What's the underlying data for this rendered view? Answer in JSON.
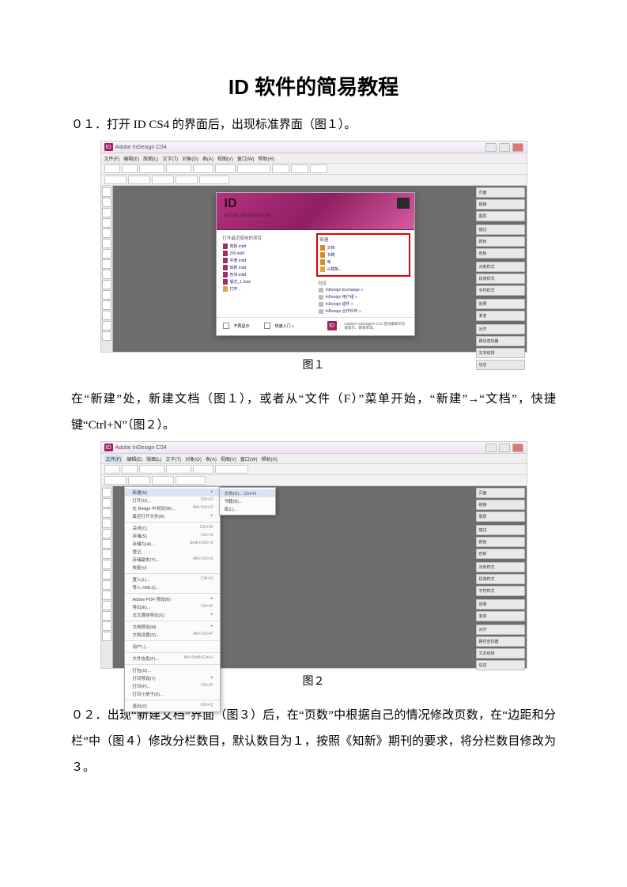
{
  "title": "ID 软件的简易教程",
  "para1": "０１．打开 ID CS4 的界面后，出现标准界面（图１）。",
  "caption1": "图１",
  "para2": "在“新建”处，新建文档（图１），或者从“文件（F）”菜单开始，“新建”→“文档”，快捷键“Ctrl+N”（图２）。",
  "caption2": "图２",
  "para3": "０２．出现“新建文档”界面（图３）后，在“页数”中根据自己的情况修改页数，在“边距和分栏”中（图４）修改分栏数目，默认数目为１，按照《知新》期刊的要求，将分栏数目修改为３。",
  "app": {
    "badge": "ID",
    "title": "Adobe InDesign CS4",
    "menus": [
      "文件(F)",
      "编辑(E)",
      "版面(L)",
      "文字(T)",
      "对象(O)",
      "表(A)",
      "视图(V)",
      "窗口(W)",
      "帮助(H)"
    ]
  },
  "welcome": {
    "logo": "ID",
    "subtitle": "ADOBE INDESIGN CS4",
    "left_title": "打开最近使用的项目",
    "left_items": [
      "知新.indd",
      "2月.indd",
      "手册.indd",
      "知新.indd",
      "色块.indd",
      "版式_1.indd",
      "打开..."
    ],
    "right_title": "新建",
    "right_items": [
      "文档",
      "书籍",
      "库",
      "从模板..."
    ],
    "comm_title": "社区",
    "comm_items": [
      "InDesign Exchange »",
      "InDesign 用户组 »",
      "InDesign 插件 »",
      "InDesign 合作伙伴 »"
    ],
    "foot_check": "不再显示",
    "foot_start": "快速入门 »",
    "foot_info": "Adobe® InDesign® CS4\n查找最新的功能提示、教程等等。"
  },
  "panels": [
    "页面",
    "链接",
    "图层",
    "描边",
    "颜色",
    "色板",
    "对象样式",
    "段落样式",
    "字符样式",
    "效果",
    "渐变",
    "对齐",
    "路径查找器",
    "文本绕排",
    "信息"
  ],
  "fileMenu": {
    "items": [
      {
        "label": "新建(N)",
        "short": "",
        "sub": true,
        "sel": true
      },
      {
        "label": "打开(O)...",
        "short": "Ctrl+O"
      },
      {
        "label": "在 Bridge 中浏览(W)...",
        "short": "Alt+Ctrl+O"
      },
      {
        "label": "最近打开文件(R)",
        "short": "",
        "sub": true
      },
      {
        "sep": true
      },
      {
        "label": "关闭(C)",
        "short": "Ctrl+W"
      },
      {
        "label": "存储(S)",
        "short": "Ctrl+S"
      },
      {
        "label": "存储为(A)...",
        "short": "Shift+Ctrl+S"
      },
      {
        "label": "登记...",
        "short": ""
      },
      {
        "label": "存储副本(Y)...",
        "short": "Alt+Ctrl+S"
      },
      {
        "label": "恢复(V)",
        "short": ""
      },
      {
        "sep": true
      },
      {
        "label": "置入(L)...",
        "short": "Ctrl+D"
      },
      {
        "label": "导入 XML(I)...",
        "short": ""
      },
      {
        "sep": true
      },
      {
        "label": "Adobe PDF 预设(B)",
        "short": "",
        "sub": true
      },
      {
        "label": "导出(E)...",
        "short": "Ctrl+E"
      },
      {
        "label": "交叉媒体导出(X)",
        "short": "",
        "sub": true
      },
      {
        "sep": true
      },
      {
        "label": "文档预设(M)",
        "short": "",
        "sub": true
      },
      {
        "label": "文档设置(D)...",
        "short": "Alt+Ctrl+P"
      },
      {
        "sep": true
      },
      {
        "label": "用户(.)...",
        "short": ""
      },
      {
        "sep": true
      },
      {
        "label": "文件信息(F)...",
        "short": "Alt+Shift+Ctrl+I"
      },
      {
        "sep": true
      },
      {
        "label": "打包(G)...",
        "short": ""
      },
      {
        "label": "打印预设(T)",
        "short": "",
        "sub": true
      },
      {
        "label": "打印(P)...",
        "short": "Ctrl+P"
      },
      {
        "label": "打印小册子(K)...",
        "short": ""
      },
      {
        "sep": true
      },
      {
        "label": "退出(X)",
        "short": "Ctrl+Q"
      }
    ],
    "submenu": [
      "文档(D)... Ctrl+N",
      "书籍(B)...",
      "库(L)..."
    ]
  }
}
